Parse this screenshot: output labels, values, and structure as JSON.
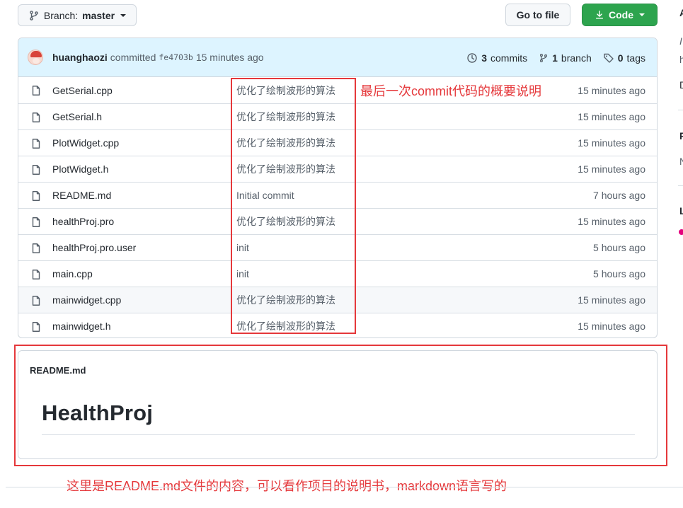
{
  "toolbar": {
    "branch_prefix": "Branch:",
    "branch_name": "master",
    "go_to_file": "Go to file",
    "code": "Code"
  },
  "commit": {
    "author": "huanghaozi",
    "action": "committed",
    "sha": "fe4703b",
    "time": "15 minutes ago",
    "commits_count": "3",
    "commits_label": "commits",
    "branch_count": "1",
    "branch_label": "branch",
    "tags_count": "0",
    "tags_label": "tags"
  },
  "files": [
    {
      "name": "GetSerial.cpp",
      "message": "优化了绘制波形的算法",
      "age": "15 minutes ago"
    },
    {
      "name": "GetSerial.h",
      "message": "优化了绘制波形的算法",
      "age": "15 minutes ago"
    },
    {
      "name": "PlotWidget.cpp",
      "message": "优化了绘制波形的算法",
      "age": "15 minutes ago"
    },
    {
      "name": "PlotWidget.h",
      "message": "优化了绘制波形的算法",
      "age": "15 minutes ago"
    },
    {
      "name": "README.md",
      "message": "Initial commit",
      "age": "7 hours ago"
    },
    {
      "name": "healthProj.pro",
      "message": "优化了绘制波形的算法",
      "age": "15 minutes ago"
    },
    {
      "name": "healthProj.pro.user",
      "message": "init",
      "age": "5 hours ago"
    },
    {
      "name": "main.cpp",
      "message": "init",
      "age": "5 hours ago"
    },
    {
      "name": "mainwidget.cpp",
      "message": "优化了绘制波形的算法",
      "age": "15 minutes ago"
    },
    {
      "name": "mainwidget.h",
      "message": "优化了绘制波形的算法",
      "age": "15 minutes ago"
    }
  ],
  "readme": {
    "filename": "README.md",
    "heading": "HealthProj"
  },
  "annotations": {
    "commit_note": "最后一次commit代码的概要说明",
    "readme_note": "这里是README.md文件的内容，可以看作项目的说明书，markdown语言写的"
  },
  "sidebar_partial": {
    "letter_a": "A",
    "letter_i": "I",
    "letter_h": "h",
    "letter_d": "D",
    "letter_r": "R",
    "letter_n": "N",
    "letter_l": "L"
  },
  "colors": {
    "accent_green": "#2da44e",
    "header_blue": "#ddf4ff",
    "annotation_red": "#e5383b",
    "language_dot": "#e4007c"
  }
}
